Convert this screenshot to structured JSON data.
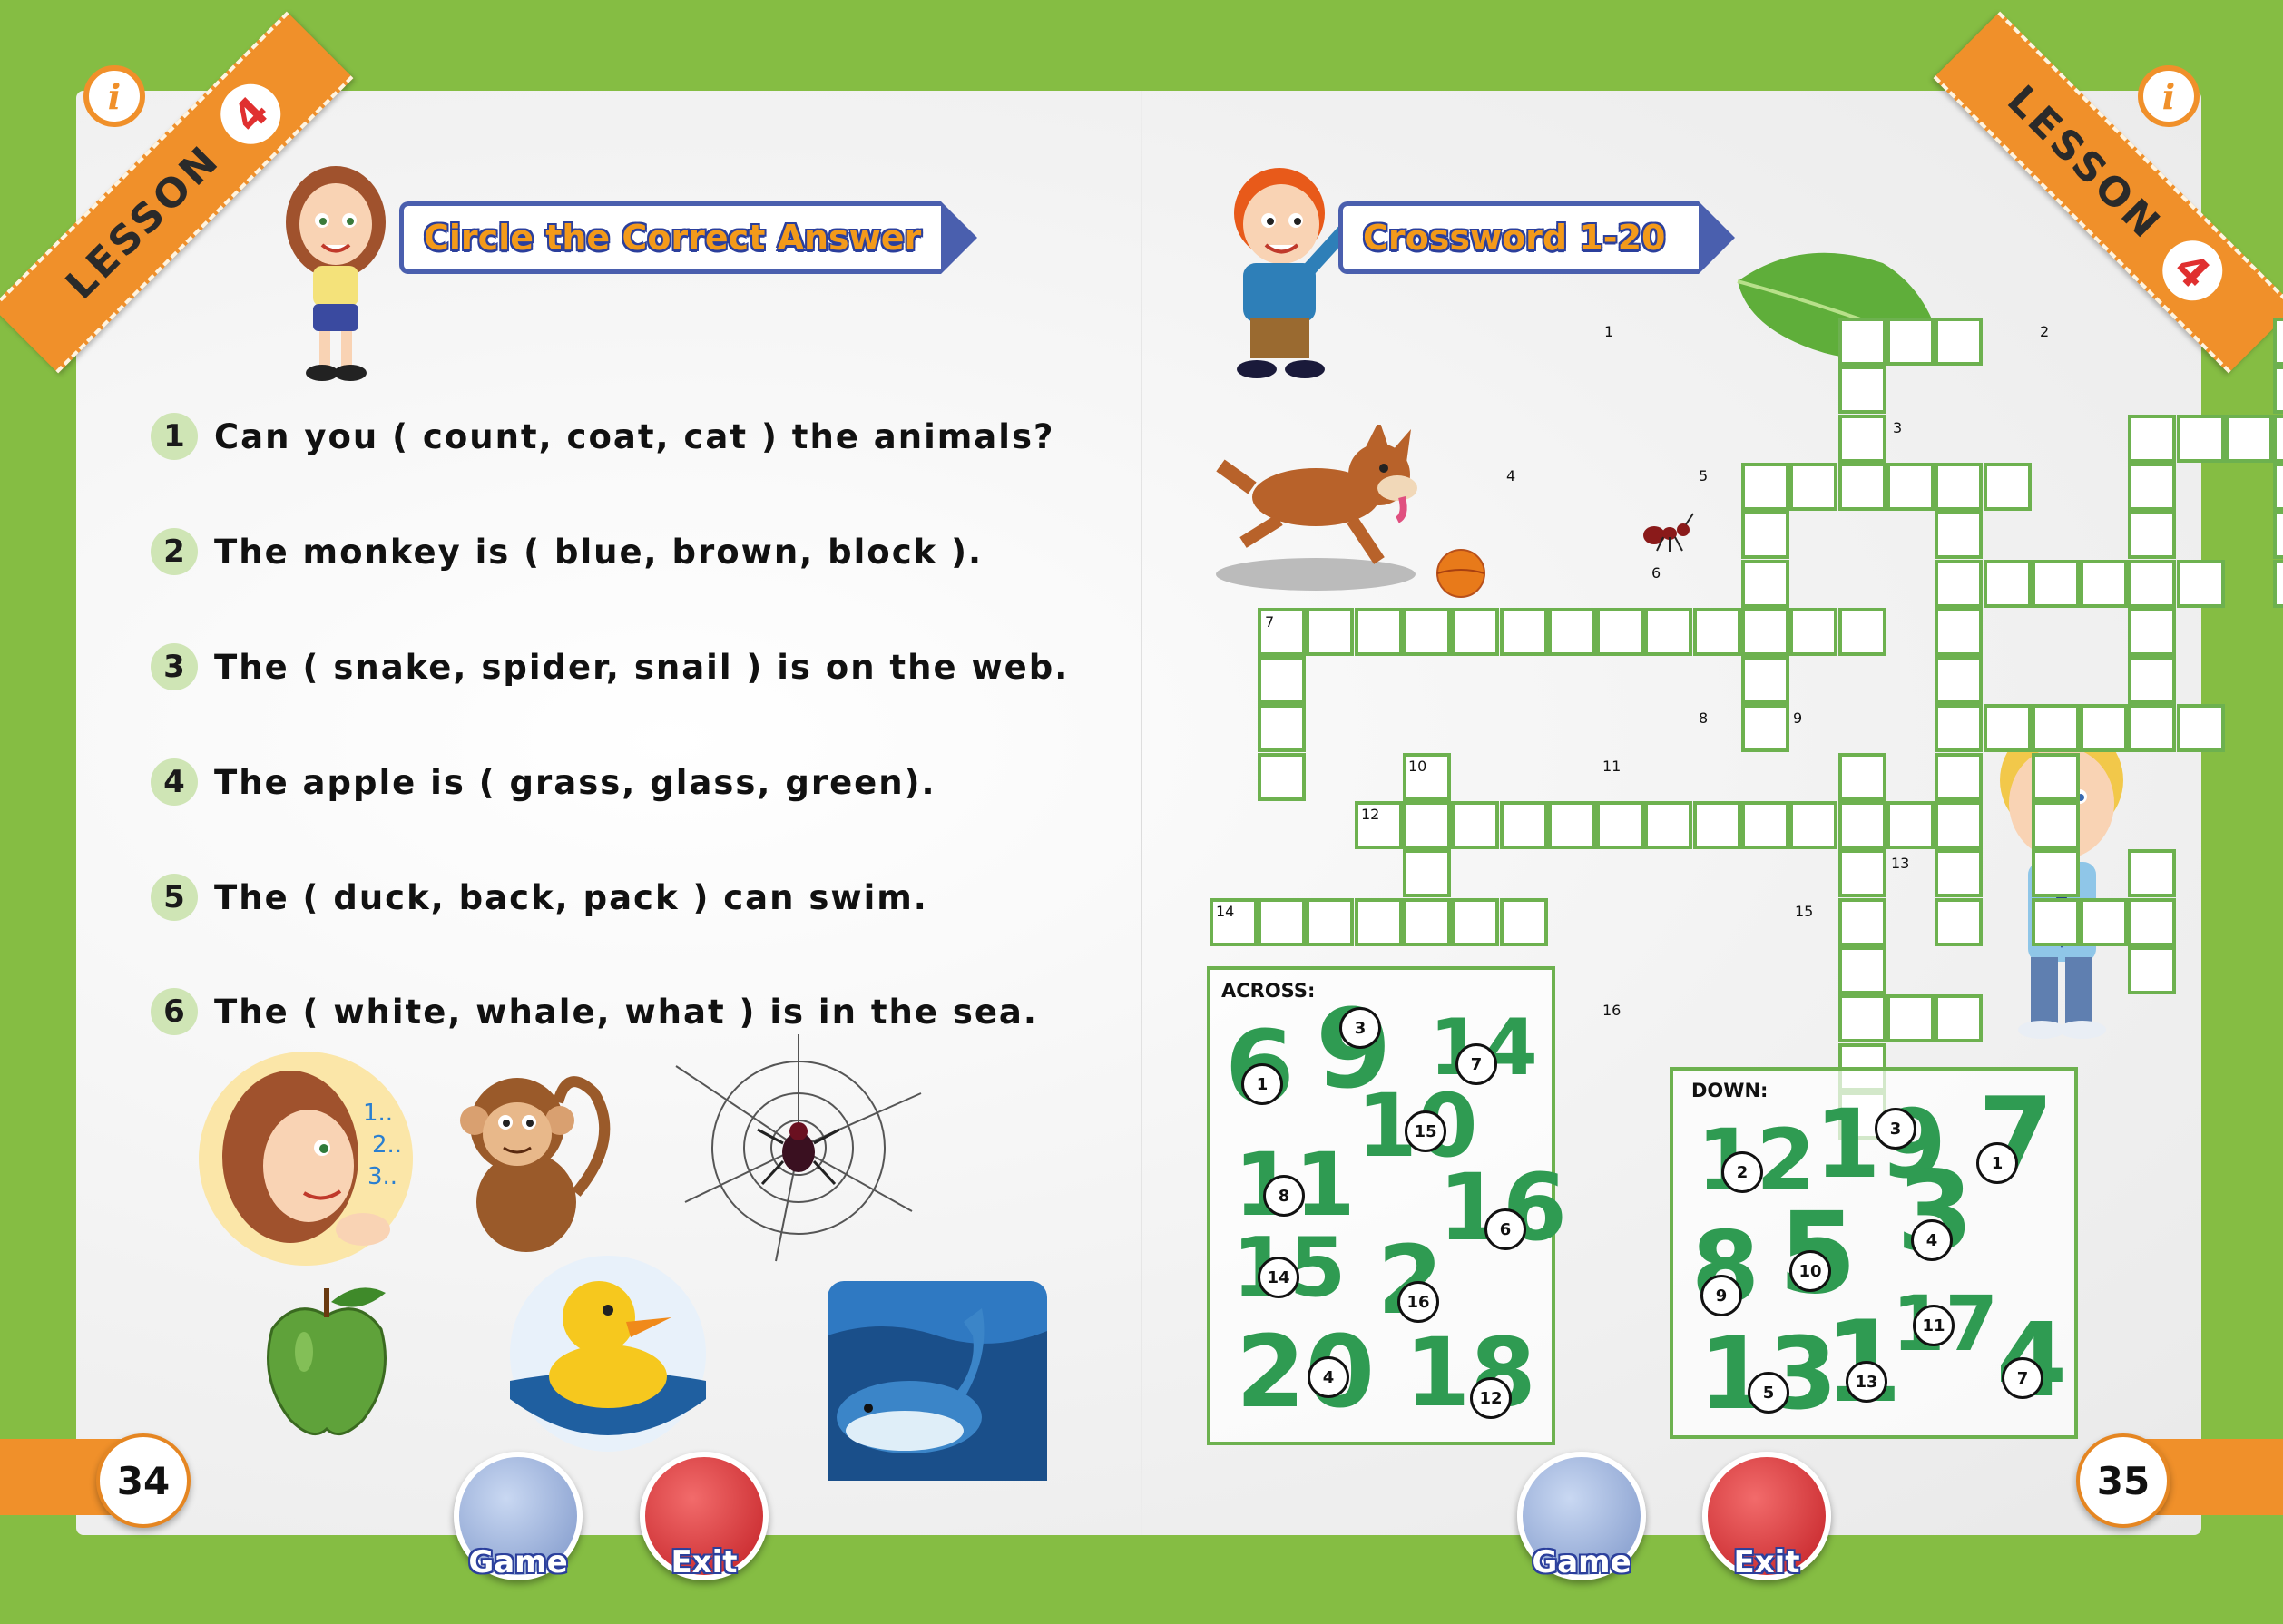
{
  "left_page": {
    "lesson_word": "LESSON",
    "lesson_number": "4",
    "header": "Circle the Correct Answer",
    "questions": [
      {
        "num": "1",
        "text": "Can you ( count, coat, cat ) the animals?"
      },
      {
        "num": "2",
        "text": "The monkey is ( blue, brown, block )."
      },
      {
        "num": "3",
        "text": "The ( snake, spider, snail ) is on the web."
      },
      {
        "num": "4",
        "text": "The apple is ( grass, glass, green)."
      },
      {
        "num": "5",
        "text": "The ( duck, back, pack ) can swim."
      },
      {
        "num": "6",
        "text": "The ( white, whale, what ) is in the sea."
      }
    ],
    "page_number": "34",
    "buttons": {
      "game": "Game",
      "exit": "Exit"
    }
  },
  "right_page": {
    "lesson_word": "LESSON",
    "lesson_number": "4",
    "header": "Crossword 1-20",
    "clue_numbers": [
      "1",
      "2",
      "3",
      "4",
      "5",
      "6",
      "7",
      "8",
      "9",
      "10",
      "11",
      "12",
      "13",
      "14",
      "15",
      "16"
    ],
    "across": {
      "title": "ACROSS:",
      "items": [
        {
          "big": "6",
          "tag": "1"
        },
        {
          "big": "9",
          "tag": "3"
        },
        {
          "big": "14",
          "tag": "7"
        },
        {
          "big": "10",
          "tag": "15"
        },
        {
          "big": "11",
          "tag": "8"
        },
        {
          "big": "16",
          "tag": "6"
        },
        {
          "big": "15",
          "tag": "14"
        },
        {
          "big": "2",
          "tag": "16"
        },
        {
          "big": "20",
          "tag": "4"
        },
        {
          "big": "18",
          "tag": "12"
        }
      ]
    },
    "down": {
      "title": "DOWN:",
      "items": [
        {
          "big": "12",
          "tag": "2"
        },
        {
          "big": "19",
          "tag": "3"
        },
        {
          "big": "7",
          "tag": "1"
        },
        {
          "big": "3",
          "tag": "4"
        },
        {
          "big": "8",
          "tag": "9"
        },
        {
          "big": "5",
          "tag": "10"
        },
        {
          "big": "17",
          "tag": "11"
        },
        {
          "big": "13",
          "tag": "5"
        },
        {
          "big": "1",
          "tag": "13"
        },
        {
          "big": "4",
          "tag": "7"
        }
      ]
    },
    "page_number": "35",
    "buttons": {
      "game": "Game",
      "exit": "Exit"
    }
  },
  "colors": {
    "background_green": "#85bd43",
    "ribbon_orange": "#f0902a",
    "grid_green": "#6db14f",
    "number_green": "#2f9b52",
    "header_blue": "#4a5fae"
  },
  "icons": [
    "info-bulb-icon",
    "puzzle-icon"
  ]
}
